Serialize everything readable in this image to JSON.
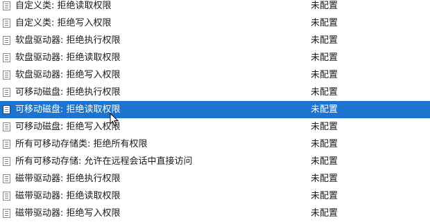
{
  "policy_list": {
    "rows": [
      {
        "name": "自定义类: 拒绝读取权限",
        "state": "未配置"
      },
      {
        "name": "自定义类: 拒绝写入权限",
        "state": "未配置"
      },
      {
        "name": "软盘驱动器: 拒绝执行权限",
        "state": "未配置"
      },
      {
        "name": "软盘驱动器: 拒绝读取权限",
        "state": "未配置"
      },
      {
        "name": "软盘驱动器: 拒绝写入权限",
        "state": "未配置"
      },
      {
        "name": "可移动磁盘: 拒绝执行权限",
        "state": "未配置"
      },
      {
        "name": "可移动磁盘: 拒绝读取权限",
        "state": "未配置",
        "selected": true
      },
      {
        "name": "可移动磁盘: 拒绝写入权限",
        "state": "未配置"
      },
      {
        "name": "所有可移动存储类: 拒绝所有权限",
        "state": "未配置"
      },
      {
        "name": "所有可移动存储: 允许在远程会话中直接访问",
        "state": "未配置"
      },
      {
        "name": "磁带驱动器: 拒绝执行权限",
        "state": "未配置"
      },
      {
        "name": "磁带驱动器: 拒绝读取权限",
        "state": "未配置"
      },
      {
        "name": "磁带驱动器: 拒绝写入权限",
        "state": "未配置"
      }
    ]
  }
}
